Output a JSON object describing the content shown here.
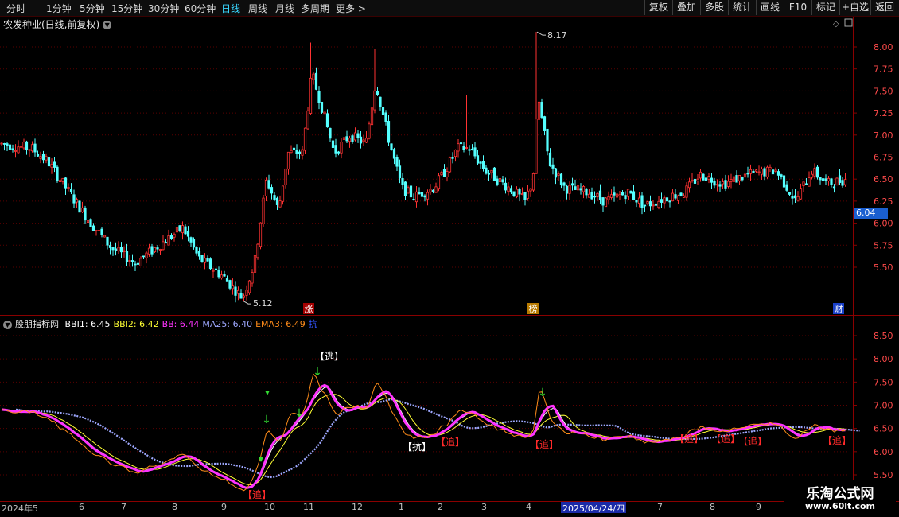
{
  "toolbar": {
    "periods": [
      "分时",
      "1分钟",
      "5分钟",
      "15分钟",
      "30分钟",
      "60分钟",
      "日线",
      "周线",
      "月线",
      "多周期",
      "更多 >"
    ],
    "active_period": "日线",
    "buttons": [
      "复权",
      "叠加",
      "多股",
      "统计",
      "画线",
      "F10",
      "标记",
      "+自选",
      "返回"
    ]
  },
  "stock": {
    "title": "农发种业(日线,前复权)"
  },
  "price_axis": [
    "8.00",
    "7.75",
    "7.50",
    "7.25",
    "7.00",
    "6.75",
    "6.50",
    "6.25",
    "6.00",
    "5.75",
    "5.50"
  ],
  "current_price": "6.04",
  "high_label": "8.17",
  "low_label": "5.12",
  "event_markers": [
    {
      "text": "涨"
    },
    {
      "text": "榜"
    },
    {
      "text": "财"
    }
  ],
  "indicator": {
    "name": "股朋指标网",
    "items": [
      {
        "label": "BBI1: 6.45",
        "color": "#ffffff"
      },
      {
        "label": "BBI2: 6.42",
        "color": "#ffff33"
      },
      {
        "label": "BB: 6.44",
        "color": "#ff33ff"
      },
      {
        "label": "MA25: 6.40",
        "color": "#9ea8ff"
      },
      {
        "label": "EMA3: 6.49",
        "color": "#ff8c1a"
      },
      {
        "label": "抗",
        "color": "#3355ff"
      }
    ]
  },
  "indicator_axis": [
    "8.50",
    "8.00",
    "7.50",
    "7.00",
    "6.50",
    "6.00",
    "5.50"
  ],
  "signals": {
    "escape": "【逃】",
    "resist": "【抗】",
    "chase": "【追】"
  },
  "date_axis": [
    "2024年5",
    "6",
    "7",
    "8",
    "9",
    "10",
    "11",
    "12",
    "1",
    "2",
    "3",
    "4",
    "7",
    "8",
    "9"
  ],
  "date_highlight": "2025/04/24/四",
  "watermark": {
    "line1": "乐淘公式网",
    "line2": "www.60lt.com"
  },
  "colors": {
    "up": "#ff3232",
    "down": "#54ffff",
    "grid": "#5a0000",
    "accent": "#39d7ff"
  }
}
